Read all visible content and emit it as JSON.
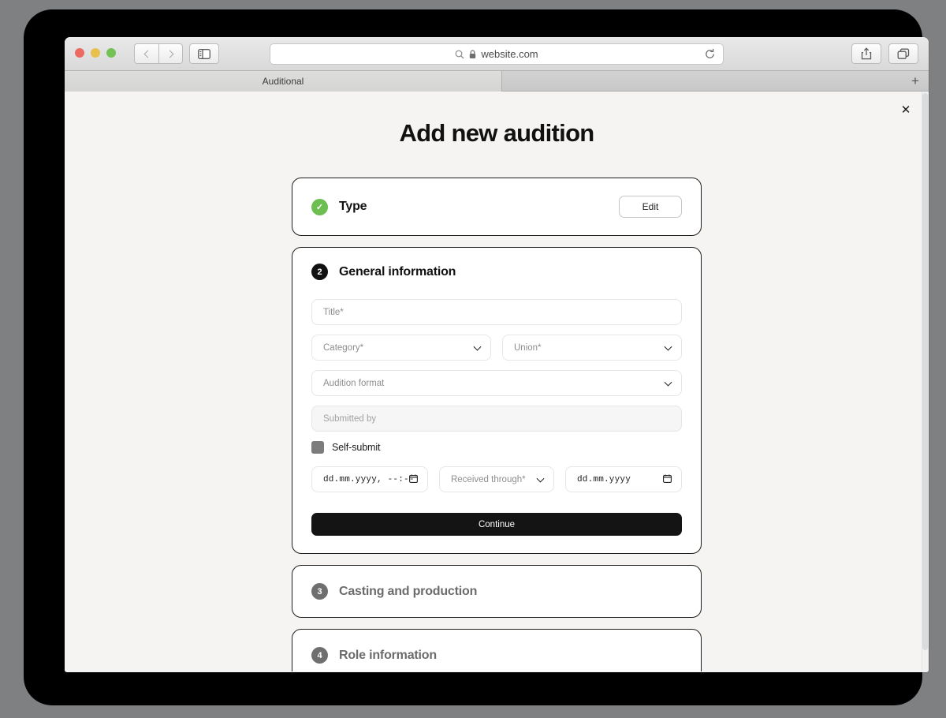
{
  "browser": {
    "url": "website.com",
    "tab_label": "Auditional",
    "new_tab_label": "+",
    "icons": {
      "search": "search-icon",
      "lock": "lock-icon",
      "reload": "reload-icon",
      "share": "share-icon",
      "tabs": "tabs-overview-icon",
      "sidebar": "sidebar-toggle-icon",
      "back": "back-chevron-icon",
      "forward": "forward-chevron-icon"
    }
  },
  "modal": {
    "close_label": "✕",
    "title": "Add new audition"
  },
  "steps": [
    {
      "number": "✓",
      "state": "done",
      "label": "Type",
      "edit_label": "Edit"
    },
    {
      "number": "2",
      "state": "active",
      "label": "General information"
    },
    {
      "number": "3",
      "state": "idle",
      "label": "Casting and production"
    },
    {
      "number": "4",
      "state": "idle",
      "label": "Role information"
    }
  ],
  "form": {
    "title_placeholder": "Title*",
    "category_placeholder": "Category*",
    "union_placeholder": "Union*",
    "audition_format_placeholder": "Audition format",
    "submitted_by_placeholder": "Submitted by",
    "self_submit_label": "Self-submit",
    "datetime_value": "dd.mm.yyyy, --:--",
    "received_through_placeholder": "Received through*",
    "date_value": "dd.mm.yyyy",
    "continue_label": "Continue"
  },
  "colors": {
    "accent_done": "#6cbe50",
    "accent_active": "#111111",
    "accent_idle": "#6f6f6f",
    "page_bg": "#f5f4f2",
    "primary_button": "#141414"
  }
}
